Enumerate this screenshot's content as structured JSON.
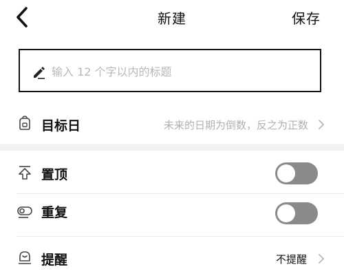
{
  "header": {
    "title": "新建",
    "save_label": "保存"
  },
  "title_input": {
    "placeholder": "输入 12 个字以内的标题",
    "value": ""
  },
  "rows": {
    "target_date": {
      "label": "目标日",
      "value": "未来的日期为倒数，反之为正数"
    },
    "pin_top": {
      "label": "置顶",
      "enabled": false
    },
    "repeat": {
      "label": "重复",
      "enabled": false
    },
    "reminder": {
      "label": "提醒",
      "value": "不提醒"
    }
  },
  "colors": {
    "toggle_off": "#8a8a8a",
    "text_primary": "#111111",
    "text_secondary": "#b9b9b9"
  },
  "icons": [
    "back-chevron-icon",
    "pencil-icon",
    "calendar-bag-icon",
    "pin-top-icon",
    "repeat-icon",
    "reminder-bell-icon",
    "chevron-right-icon"
  ]
}
